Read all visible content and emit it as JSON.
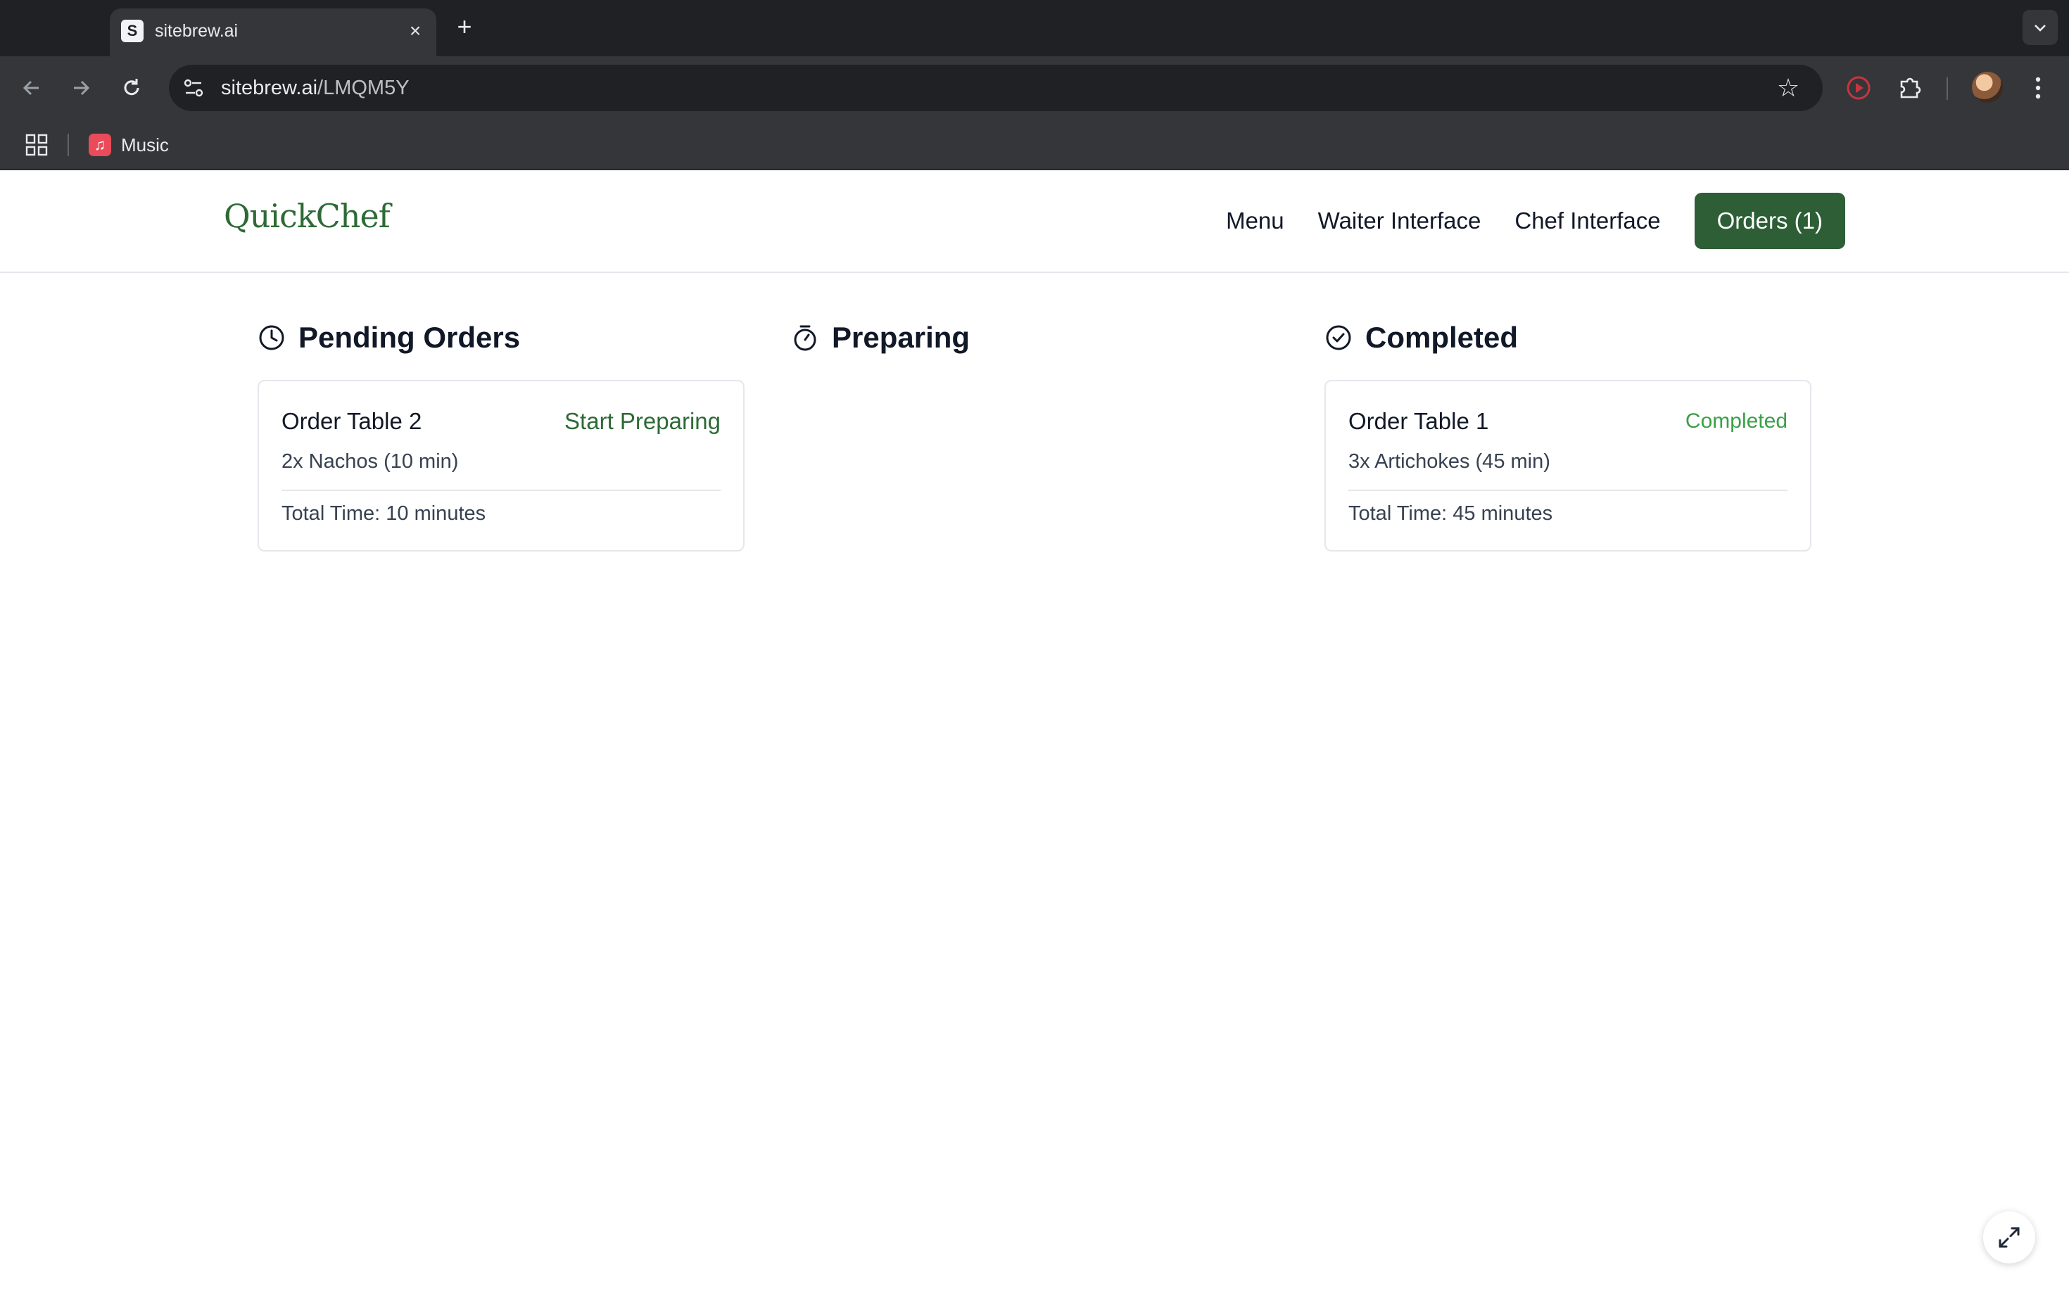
{
  "browser": {
    "tab": {
      "title": "sitebrew.ai",
      "favicon_letter": "S",
      "close_icon": "close-icon"
    },
    "new_tab_label": "+",
    "address": {
      "domain": "sitebrew.ai",
      "path": "/LMQM5Y"
    },
    "bookmarks": [
      {
        "label": "Music",
        "icon": "music-icon"
      }
    ]
  },
  "app": {
    "logo": "QuickChef",
    "nav": {
      "menu": "Menu",
      "waiter": "Waiter Interface",
      "chef": "Chef Interface",
      "orders": "Orders (1)"
    },
    "accent_color": "#2d5e35"
  },
  "board": {
    "pending": {
      "title": "Pending Orders",
      "icon": "clock-icon",
      "orders": [
        {
          "title": "Order Table 2",
          "action": "Start Preparing",
          "item": "2x Nachos (10 min)",
          "total": "Total Time: 10 minutes"
        }
      ]
    },
    "preparing": {
      "title": "Preparing",
      "icon": "stopwatch-icon",
      "orders": []
    },
    "completed": {
      "title": "Completed",
      "icon": "check-circle-icon",
      "orders": [
        {
          "title": "Order Table 1",
          "status": "Completed",
          "item": "3x Artichokes (45 min)",
          "total": "Total Time: 45 minutes"
        }
      ]
    }
  }
}
